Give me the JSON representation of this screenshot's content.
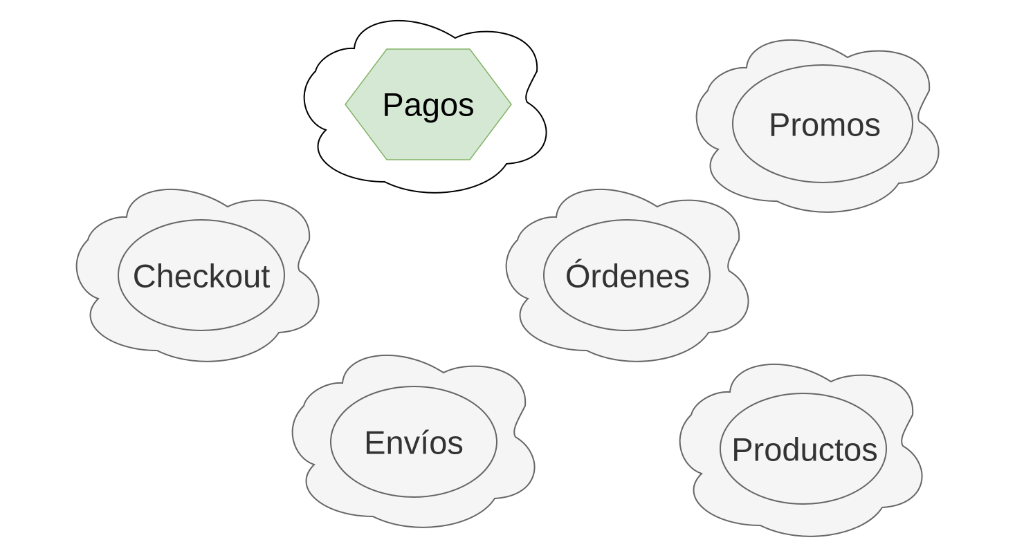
{
  "diagram": {
    "nodes": [
      {
        "id": "pagos",
        "label": "Pagos",
        "cloud_fill": "#ffffff",
        "cloud_stroke": "#000000",
        "inner_shape": "hexagon",
        "inner_fill": "#d5e8d4",
        "inner_stroke": "#82b366",
        "text_color": "#000000",
        "highlighted": true
      },
      {
        "id": "promos",
        "label": "Promos",
        "cloud_fill": "#f5f5f5",
        "cloud_stroke": "#666666",
        "inner_shape": "ellipse",
        "inner_fill": "#f5f5f5",
        "inner_stroke": "#666666",
        "text_color": "#333333",
        "highlighted": false
      },
      {
        "id": "checkout",
        "label": "Checkout",
        "cloud_fill": "#f5f5f5",
        "cloud_stroke": "#666666",
        "inner_shape": "ellipse",
        "inner_fill": "#f5f5f5",
        "inner_stroke": "#666666",
        "text_color": "#333333",
        "highlighted": false
      },
      {
        "id": "ordenes",
        "label": "Órdenes",
        "cloud_fill": "#f5f5f5",
        "cloud_stroke": "#666666",
        "inner_shape": "ellipse",
        "inner_fill": "#f5f5f5",
        "inner_stroke": "#666666",
        "text_color": "#333333",
        "highlighted": false
      },
      {
        "id": "envios",
        "label": "Envíos",
        "cloud_fill": "#f5f5f5",
        "cloud_stroke": "#666666",
        "inner_shape": "ellipse",
        "inner_fill": "#f5f5f5",
        "inner_stroke": "#666666",
        "text_color": "#333333",
        "highlighted": false
      },
      {
        "id": "productos",
        "label": "Productos",
        "cloud_fill": "#f5f5f5",
        "cloud_stroke": "#666666",
        "inner_shape": "ellipse",
        "inner_fill": "#f5f5f5",
        "inner_stroke": "#666666",
        "text_color": "#333333",
        "highlighted": false
      }
    ]
  }
}
